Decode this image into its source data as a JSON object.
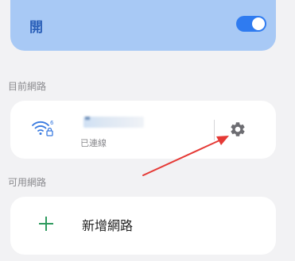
{
  "wifi": {
    "toggle_label": "開",
    "toggle_state": "on"
  },
  "sections": {
    "current_label": "目前網路",
    "available_label": "可用網路"
  },
  "current_network": {
    "status": "已連線"
  },
  "add_network": {
    "label": "新增網路"
  },
  "icons": {
    "wifi": "wifi-locked-icon",
    "settings": "gear-icon",
    "add": "plus-icon"
  },
  "colors": {
    "accent": "#2f7bf0",
    "toggle_bar": "#a8c9f5",
    "plus": "#2e9a5e",
    "annotation_arrow": "#e53935"
  }
}
